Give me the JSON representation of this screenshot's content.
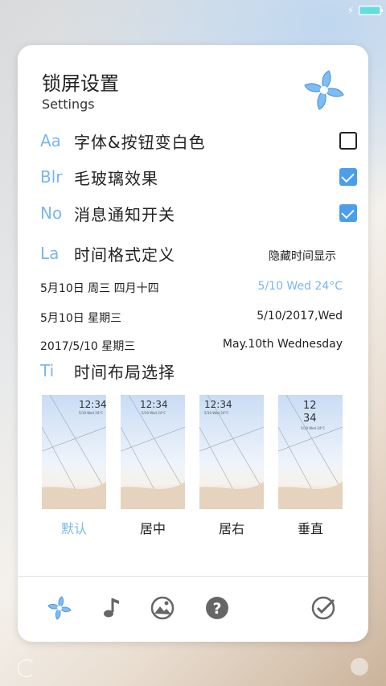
{
  "header": {
    "title": "锁屏设置",
    "subtitle": "Settings",
    "logo_icon": "pinwheel-icon"
  },
  "colors": {
    "accent": "#79b6f0",
    "checkbox_on": "#4a9eea",
    "battery_fill": "#5fe0e0"
  },
  "status_bar": {
    "charging_icon": "bolt-icon",
    "battery_level": 1.0
  },
  "options": [
    {
      "prefix": "Aa",
      "label": "字体&按钮变白色",
      "checked": false
    },
    {
      "prefix": "Blr",
      "label": "毛玻璃效果",
      "checked": true
    },
    {
      "prefix": "No",
      "label": "消息通知开关",
      "checked": true
    }
  ],
  "time_format": {
    "prefix": "La",
    "label": "时间格式定义",
    "hide_label": "隐藏时间显示",
    "rows": [
      {
        "left": "5月10日  周三  四月十四",
        "right": "5/10  Wed  24°C",
        "highlight": true
      },
      {
        "left": "5月10日  星期三",
        "right": "5/10/2017,Wed",
        "highlight": false
      },
      {
        "left": "2017/5/10  星期三",
        "right": "May.10th  Wednesday",
        "highlight": false
      }
    ]
  },
  "layout": {
    "prefix": "Ti",
    "label": "时间布局选择",
    "options": [
      {
        "label": "默认",
        "time": "12:34",
        "date": "5/10  Wed  24°C",
        "selected": true
      },
      {
        "label": "居中",
        "time": "12:34",
        "date": "5/10  Wed  24°C",
        "selected": false
      },
      {
        "label": "居右",
        "time": "12:34",
        "date": "5/10  Wed  24°C",
        "selected": false
      },
      {
        "label": "垂直",
        "time_top": "12",
        "time_bottom": "34",
        "date": "5/10  Wed  24°C",
        "selected": false
      }
    ]
  },
  "bottom_bar": {
    "icons": [
      "pinwheel-icon",
      "music-note-icon",
      "image-icon",
      "help-icon",
      "confirm-check-icon"
    ]
  }
}
